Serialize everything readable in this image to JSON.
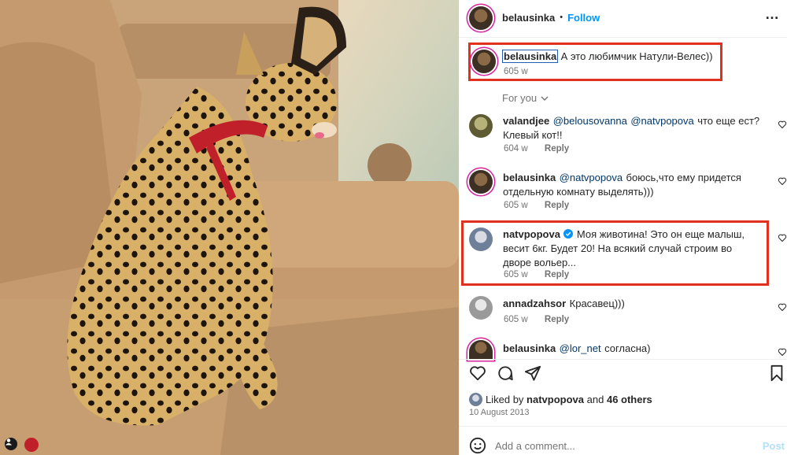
{
  "header": {
    "username": "belausinka",
    "separator": "•",
    "follow_label": "Follow",
    "more_label": "…"
  },
  "caption": {
    "username": "belausinka",
    "text": "А это любимчик Натули-Велес))",
    "time": "605 w"
  },
  "filter": {
    "label": "For you"
  },
  "comments": [
    {
      "username": "valandjee",
      "mention1": "@belousovanna",
      "mention2": "@natvpopova",
      "text": "что еще ест? Клевый кот!!",
      "time": "604 w",
      "reply": "Reply"
    },
    {
      "username": "belausinka",
      "mention1": "@natvpopova",
      "text": "боюсь,что ему придется отдельную комнату выделять)))",
      "time": "605 w",
      "reply": "Reply"
    },
    {
      "username": "natvpopova",
      "text": "Моя животина! Это он еще малыш, весит 6кг. Будет 20! На всякий случай строим во дворе вольер...",
      "time": "605 w",
      "reply": "Reply"
    },
    {
      "username": "annadzahsor",
      "text": "Красавец)))",
      "time": "605 w",
      "reply": "Reply"
    },
    {
      "username": "belausinka",
      "mention1": "@lor_net",
      "text": "согласна)"
    }
  ],
  "likes": {
    "prefix": "Liked by",
    "user": "natvpopova",
    "and": "and",
    "others": "46 others",
    "date": "10 August 2013"
  },
  "add_comment": {
    "placeholder": "Add a comment...",
    "post_label": "Post"
  },
  "icons": {
    "verified_color": "#0095f6",
    "highlight_color": "#e0301e",
    "link_color": "#0095f6"
  }
}
